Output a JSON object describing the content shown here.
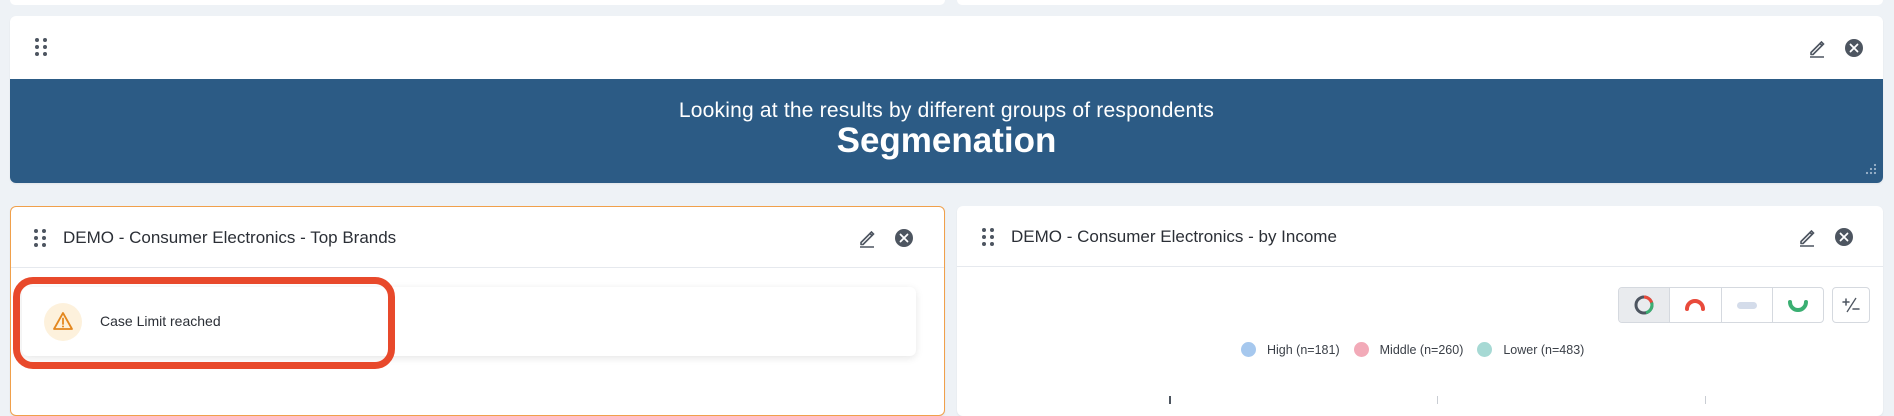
{
  "colors": {
    "banner_bg": "#2c5b85",
    "highlight_border": "#e8492b",
    "selected_border": "#f0a04b",
    "warning": "#e3871f",
    "close_icon": "#4d5560"
  },
  "banner_widget": {
    "subtitle": "Looking at the results by different groups of respondents",
    "title": "Segmenation"
  },
  "left_widget": {
    "title": "DEMO - Consumer Electronics - Top Brands",
    "alert": {
      "icon": "warning-triangle-icon",
      "text": "Case Limit reached"
    }
  },
  "right_widget": {
    "title": "DEMO - Consumer Electronics - by Income",
    "chart_type_options": [
      {
        "icon": "donut-chart-icon",
        "selected": true
      },
      {
        "icon": "half-donut-icon",
        "selected": false
      },
      {
        "icon": "pill-bar-icon",
        "selected": false
      },
      {
        "icon": "smile-arc-icon",
        "selected": false
      }
    ],
    "plus_minus_icon": "plus-minus-icon",
    "chart_data": {
      "type": "bar",
      "series": [
        {
          "name": "High (n=181)",
          "color": "#a6c8ee"
        },
        {
          "name": "Middle (n=260)",
          "color": "#f2aab8"
        },
        {
          "name": "Lower (n=483)",
          "color": "#a6d9d4"
        }
      ],
      "legend_placement": "top-center"
    }
  }
}
